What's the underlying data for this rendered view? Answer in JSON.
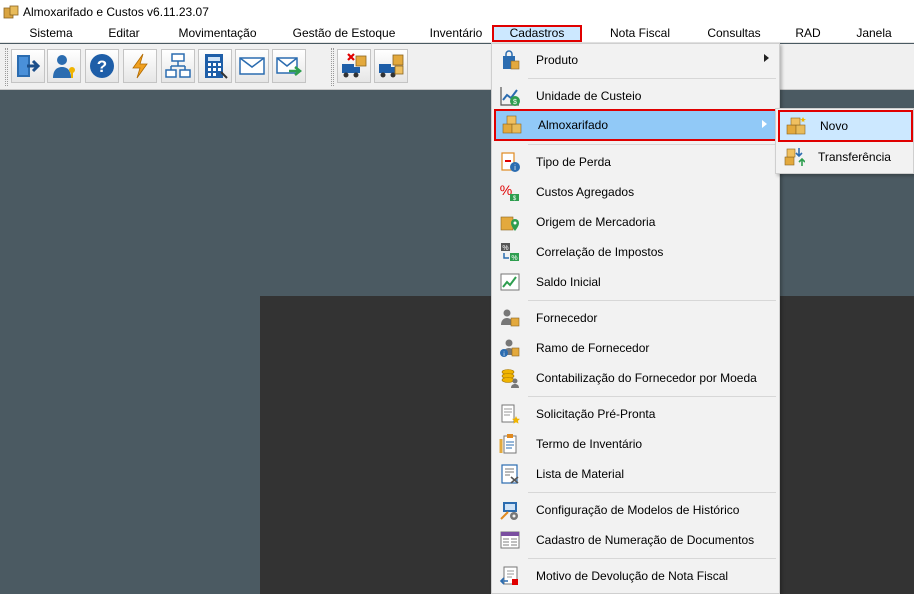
{
  "window": {
    "title": "Almoxarifado e Custos v6.11.23.07"
  },
  "menubar": {
    "items": [
      "Sistema",
      "Editar",
      "Movimentação",
      "Gestão de Estoque",
      "Inventário",
      "Cadastros",
      "Nota Fiscal",
      "Consultas",
      "RAD",
      "Janela"
    ],
    "active": "Cadastros"
  },
  "toolbar": {
    "buttons": [
      "exit-icon",
      "user-key-icon",
      "help-icon",
      "lightning-icon",
      "org-chart-icon",
      "calculator-icon",
      "envelope-icon",
      "mail-send-icon",
      "truck-remove-icon",
      "truck-boxes-icon"
    ]
  },
  "cadastros_menu": {
    "items": [
      {
        "label": "Produto",
        "icon": "product-bag-icon",
        "submenu": true
      },
      {
        "label": "Unidade de Custeio",
        "icon": "chart-money-icon"
      },
      {
        "label": "Almoxarifado",
        "icon": "warehouse-boxes-icon",
        "submenu": true,
        "highlighted": true
      },
      {
        "label": "Tipo de Perda",
        "icon": "loss-doc-icon"
      },
      {
        "label": "Custos Agregados",
        "icon": "percent-icon"
      },
      {
        "label": "Origem de Mercadoria",
        "icon": "origin-location-icon"
      },
      {
        "label": "Correlação de Impostos",
        "icon": "tax-percent-icon"
      },
      {
        "label": "Saldo Inicial",
        "icon": "balance-chart-icon"
      },
      {
        "label": "Fornecedor",
        "icon": "supplier-icon"
      },
      {
        "label": "Ramo de Fornecedor",
        "icon": "supplier-branch-icon"
      },
      {
        "label": "Contabilização do Fornecedor por Moeda",
        "icon": "coins-user-icon"
      },
      {
        "label": "Solicitação Pré-Pronta",
        "icon": "request-doc-icon"
      },
      {
        "label": "Termo de Inventário",
        "icon": "inventory-doc-icon"
      },
      {
        "label": "Lista de Material",
        "icon": "material-list-icon"
      },
      {
        "label": "Configuração de Modelos de Histórico",
        "icon": "history-config-icon"
      },
      {
        "label": "Cadastro de Numeração de Documentos",
        "icon": "numbering-icon"
      },
      {
        "label": "Motivo de Devolução de Nota Fiscal",
        "icon": "return-invoice-icon"
      }
    ]
  },
  "almoxarifado_submenu": {
    "items": [
      {
        "label": "Novo",
        "icon": "new-warehouse-icon",
        "highlighted": true
      },
      {
        "label": "Transferência",
        "icon": "transfer-icon"
      }
    ]
  },
  "colors": {
    "highlight_blue": "#91c9f7",
    "menu_active_blue": "#cce8ff",
    "annotation_red": "#e00000",
    "workspace": "#4b5a62",
    "dark_panel": "#333333"
  }
}
